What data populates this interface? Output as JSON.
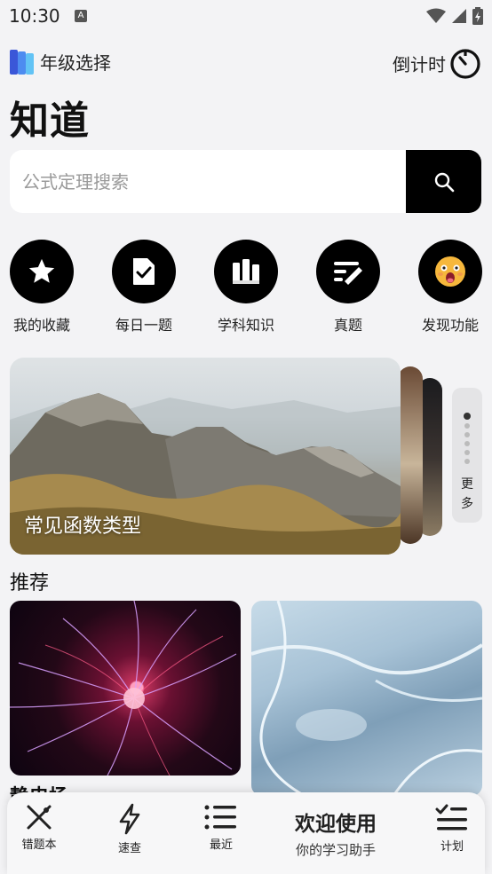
{
  "status": {
    "time": "10:30",
    "notification_letter": "A"
  },
  "header": {
    "grade_label": "年级选择",
    "countdown_label": "倒计时",
    "app_title": "知道"
  },
  "search": {
    "placeholder": "公式定理搜索"
  },
  "quick_actions": [
    {
      "label": "我的收藏",
      "icon": "star-icon"
    },
    {
      "label": "每日一题",
      "icon": "checked-document-icon"
    },
    {
      "label": "学科知识",
      "icon": "books-icon"
    },
    {
      "label": "真题",
      "icon": "pen-lines-icon"
    },
    {
      "label": "发现功能",
      "icon": "surprised-emoji-icon"
    }
  ],
  "banner": {
    "label": "常见函数类型",
    "more_label": "更多",
    "page_indicator": {
      "current": 1,
      "total": 6
    }
  },
  "recommend": {
    "title": "推荐",
    "first_card_caption": "静电场"
  },
  "bottom_nav": {
    "items": [
      {
        "label": "错题本",
        "icon": "wrong-cross-icon"
      },
      {
        "label": "速查",
        "icon": "lightning-icon"
      },
      {
        "label": "最近",
        "icon": "list-icon"
      },
      {
        "label": "计划",
        "icon": "checklist-icon"
      }
    ],
    "welcome_title": "欢迎使用",
    "welcome_subtitle": "你的学习助手"
  }
}
